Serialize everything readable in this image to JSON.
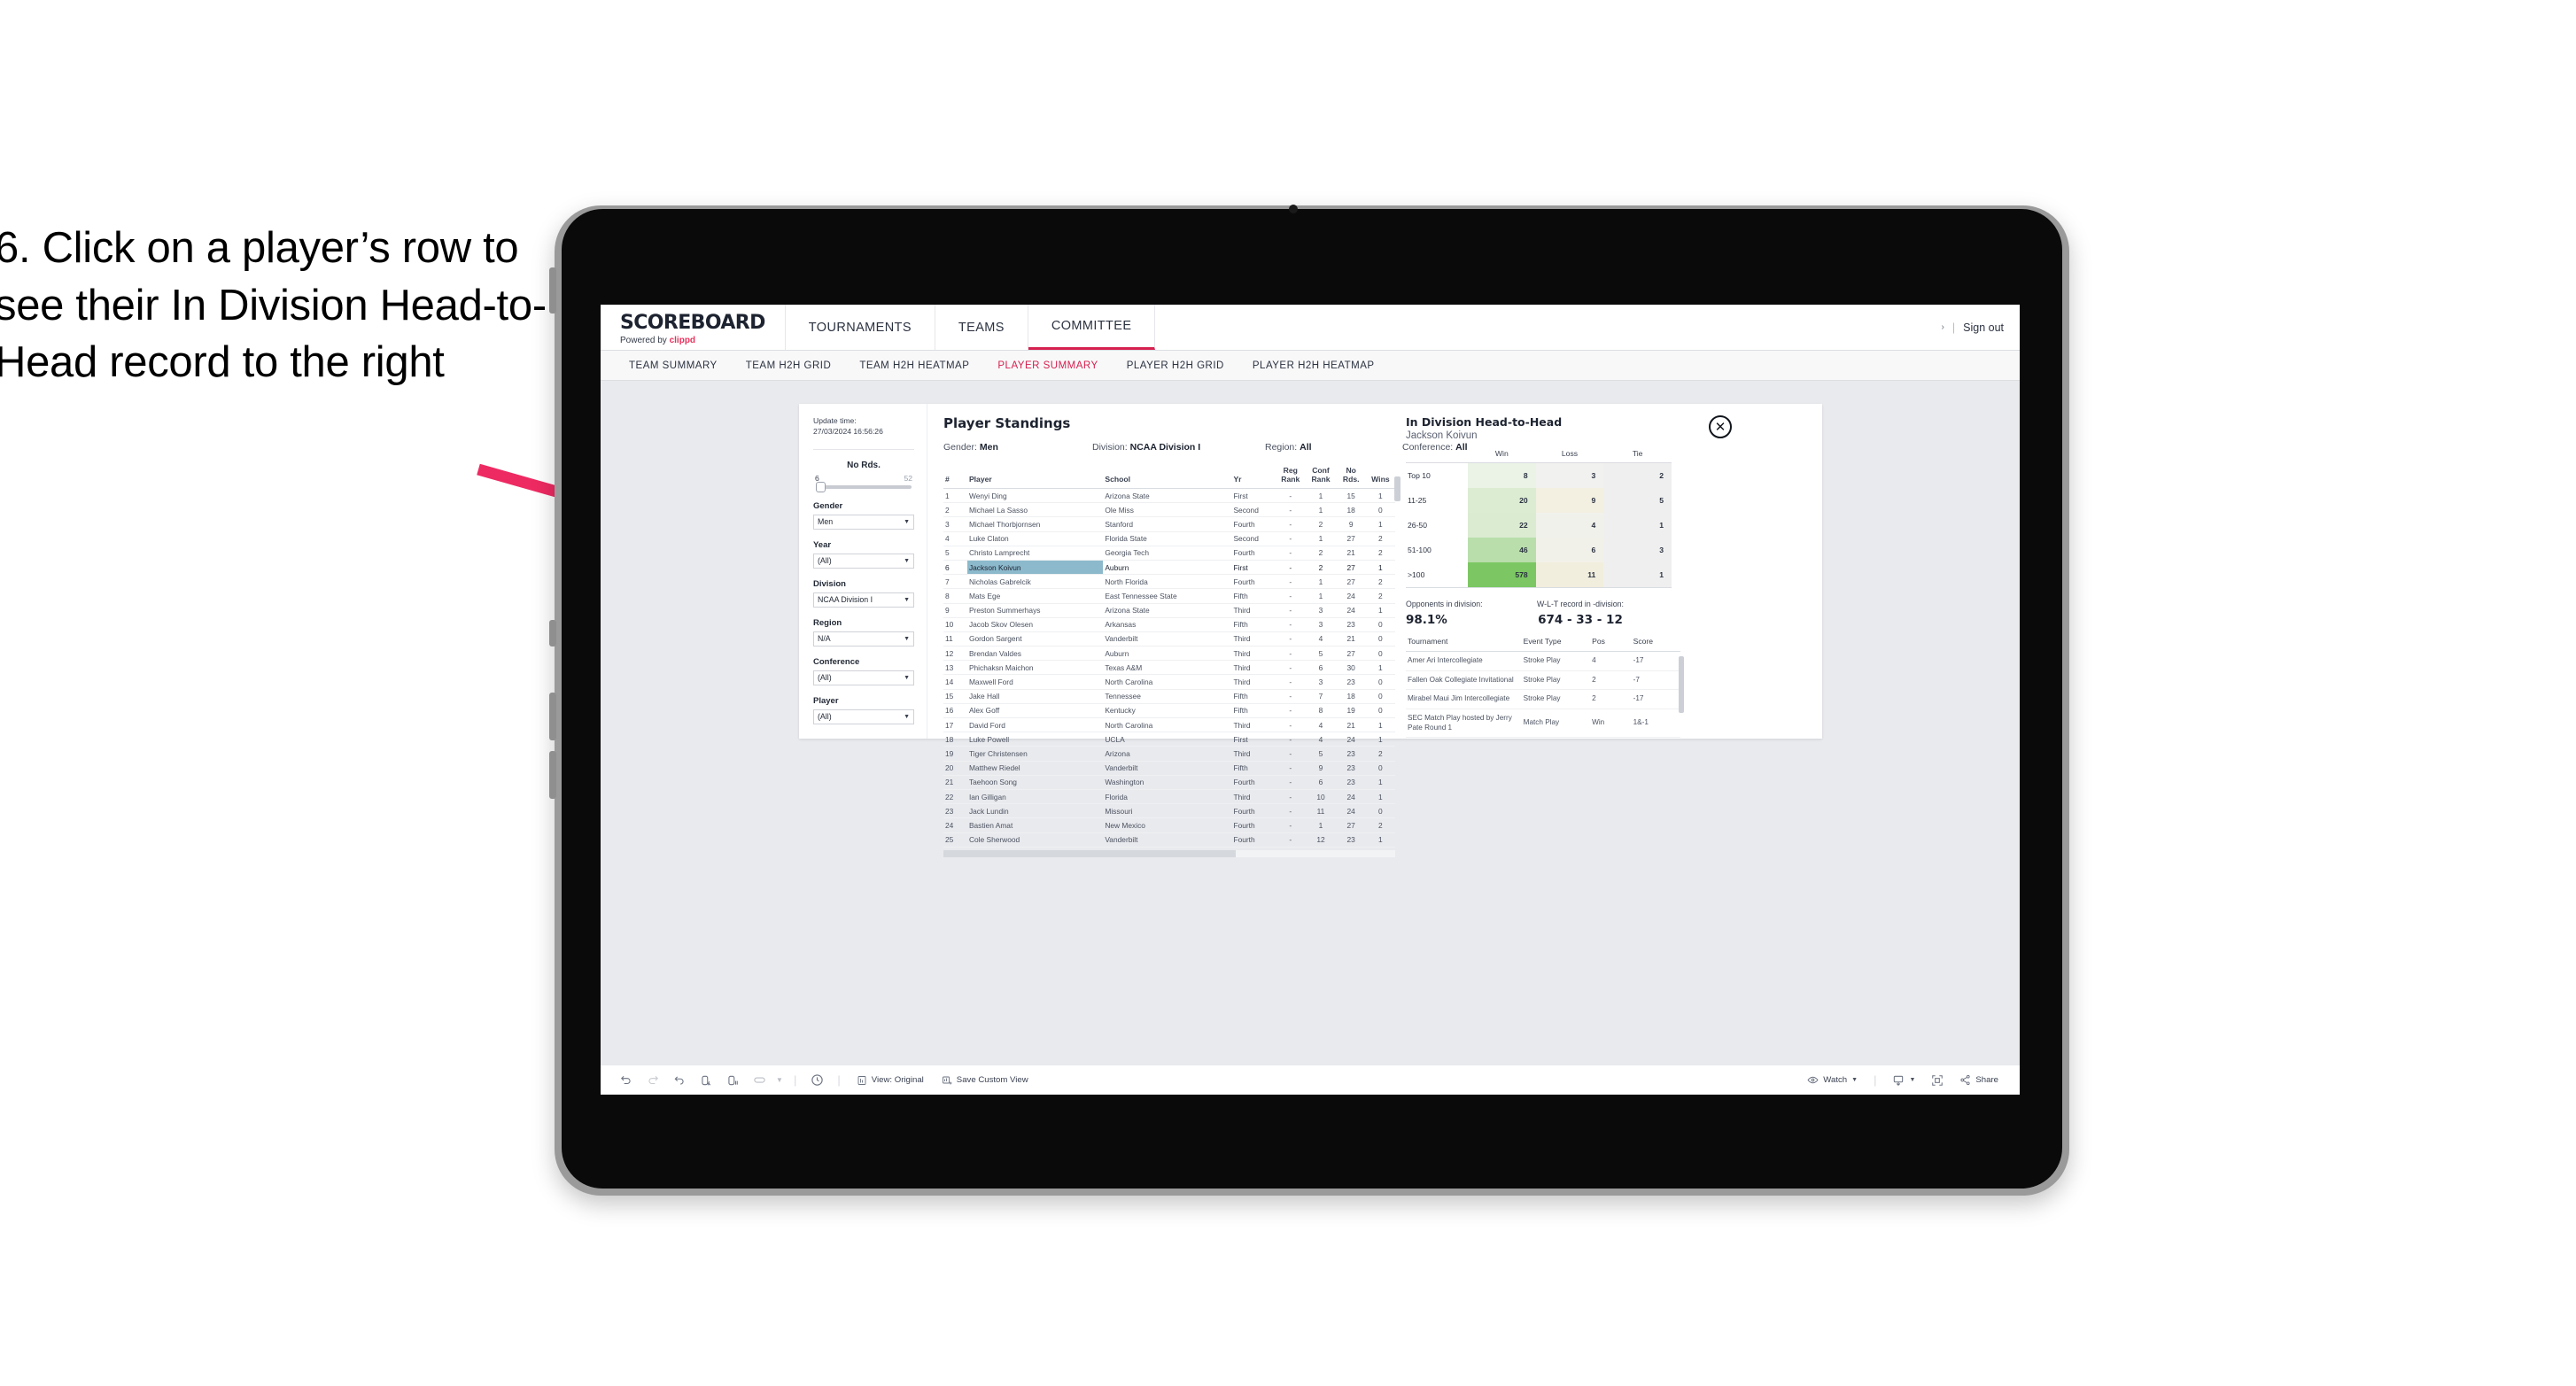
{
  "annotation": {
    "text": "6. Click on a player’s row to see their In Division Head-to-Head record to the right",
    "arrow_color": "#ee2a62"
  },
  "brand": {
    "title": "SCOREBOARD",
    "powered_prefix": "Powered by ",
    "powered_name": "clippd"
  },
  "topnav": {
    "items": [
      {
        "label": "TOURNAMENTS",
        "active": false
      },
      {
        "label": "TEAMS",
        "active": false
      },
      {
        "label": "COMMITTEE",
        "active": true
      }
    ],
    "chevron": "›",
    "separator": "|",
    "sign_out": "Sign out"
  },
  "subnav": {
    "items": [
      {
        "label": "TEAM SUMMARY",
        "active": false
      },
      {
        "label": "TEAM H2H GRID",
        "active": false
      },
      {
        "label": "TEAM H2H HEATMAP",
        "active": false
      },
      {
        "label": "PLAYER SUMMARY",
        "active": true
      },
      {
        "label": "PLAYER H2H GRID",
        "active": false
      },
      {
        "label": "PLAYER H2H HEATMAP",
        "active": false
      }
    ]
  },
  "filters": {
    "update_label": "Update time:",
    "update_time": "27/03/2024 16:56:26",
    "slider": {
      "title": "No Rds.",
      "min": "6",
      "max": "52"
    },
    "groups": [
      {
        "label": "Gender",
        "value": "Men"
      },
      {
        "label": "Year",
        "value": "(All)"
      },
      {
        "label": "Division",
        "value": "NCAA Division I"
      },
      {
        "label": "Region",
        "value": "N/A"
      },
      {
        "label": "Conference",
        "value": "(All)"
      },
      {
        "label": "Player",
        "value": "(All)"
      }
    ]
  },
  "standings": {
    "title": "Player Standings",
    "meta": [
      {
        "label": "Gender: ",
        "value": "Men"
      },
      {
        "label": "Division: ",
        "value": "NCAA Division I"
      },
      {
        "label": "Region: ",
        "value": "All"
      },
      {
        "label": "Conference: ",
        "value": "All"
      }
    ],
    "columns": [
      "#",
      "Player",
      "School",
      "Yr",
      "Reg Rank",
      "Conf Rank",
      "No Rds.",
      "Wins"
    ],
    "rows": [
      {
        "n": "1",
        "player": "Wenyi Ding",
        "school": "Arizona State",
        "yr": "First",
        "reg": "-",
        "conf": "1",
        "rds": "15",
        "wins": "1",
        "selected": false
      },
      {
        "n": "2",
        "player": "Michael La Sasso",
        "school": "Ole Miss",
        "yr": "Second",
        "reg": "-",
        "conf": "1",
        "rds": "18",
        "wins": "0",
        "selected": false
      },
      {
        "n": "3",
        "player": "Michael Thorbjornsen",
        "school": "Stanford",
        "yr": "Fourth",
        "reg": "-",
        "conf": "2",
        "rds": "9",
        "wins": "1",
        "selected": false
      },
      {
        "n": "4",
        "player": "Luke Claton",
        "school": "Florida State",
        "yr": "Second",
        "reg": "-",
        "conf": "1",
        "rds": "27",
        "wins": "2",
        "selected": false
      },
      {
        "n": "5",
        "player": "Christo Lamprecht",
        "school": "Georgia Tech",
        "yr": "Fourth",
        "reg": "-",
        "conf": "2",
        "rds": "21",
        "wins": "2",
        "selected": false
      },
      {
        "n": "6",
        "player": "Jackson Koivun",
        "school": "Auburn",
        "yr": "First",
        "reg": "-",
        "conf": "2",
        "rds": "27",
        "wins": "1",
        "selected": true
      },
      {
        "n": "7",
        "player": "Nicholas Gabrelcik",
        "school": "North Florida",
        "yr": "Fourth",
        "reg": "-",
        "conf": "1",
        "rds": "27",
        "wins": "2",
        "selected": false
      },
      {
        "n": "8",
        "player": "Mats Ege",
        "school": "East Tennessee State",
        "yr": "Fifth",
        "reg": "-",
        "conf": "1",
        "rds": "24",
        "wins": "2",
        "selected": false
      },
      {
        "n": "9",
        "player": "Preston Summerhays",
        "school": "Arizona State",
        "yr": "Third",
        "reg": "-",
        "conf": "3",
        "rds": "24",
        "wins": "1",
        "selected": false
      },
      {
        "n": "10",
        "player": "Jacob Skov Olesen",
        "school": "Arkansas",
        "yr": "Fifth",
        "reg": "-",
        "conf": "3",
        "rds": "23",
        "wins": "0",
        "selected": false
      },
      {
        "n": "11",
        "player": "Gordon Sargent",
        "school": "Vanderbilt",
        "yr": "Third",
        "reg": "-",
        "conf": "4",
        "rds": "21",
        "wins": "0",
        "selected": false
      },
      {
        "n": "12",
        "player": "Brendan Valdes",
        "school": "Auburn",
        "yr": "Third",
        "reg": "-",
        "conf": "5",
        "rds": "27",
        "wins": "0",
        "selected": false
      },
      {
        "n": "13",
        "player": "Phichaksn Maichon",
        "school": "Texas A&M",
        "yr": "Third",
        "reg": "-",
        "conf": "6",
        "rds": "30",
        "wins": "1",
        "selected": false
      },
      {
        "n": "14",
        "player": "Maxwell Ford",
        "school": "North Carolina",
        "yr": "Third",
        "reg": "-",
        "conf": "3",
        "rds": "23",
        "wins": "0",
        "selected": false
      },
      {
        "n": "15",
        "player": "Jake Hall",
        "school": "Tennessee",
        "yr": "Fifth",
        "reg": "-",
        "conf": "7",
        "rds": "18",
        "wins": "0",
        "selected": false
      },
      {
        "n": "16",
        "player": "Alex Goff",
        "school": "Kentucky",
        "yr": "Fifth",
        "reg": "-",
        "conf": "8",
        "rds": "19",
        "wins": "0",
        "selected": false
      },
      {
        "n": "17",
        "player": "David Ford",
        "school": "North Carolina",
        "yr": "Third",
        "reg": "-",
        "conf": "4",
        "rds": "21",
        "wins": "1",
        "selected": false
      },
      {
        "n": "18",
        "player": "Luke Powell",
        "school": "UCLA",
        "yr": "First",
        "reg": "-",
        "conf": "4",
        "rds": "24",
        "wins": "1",
        "selected": false
      },
      {
        "n": "19",
        "player": "Tiger Christensen",
        "school": "Arizona",
        "yr": "Third",
        "reg": "-",
        "conf": "5",
        "rds": "23",
        "wins": "2",
        "selected": false
      },
      {
        "n": "20",
        "player": "Matthew Riedel",
        "school": "Vanderbilt",
        "yr": "Fifth",
        "reg": "-",
        "conf": "9",
        "rds": "23",
        "wins": "0",
        "selected": false
      },
      {
        "n": "21",
        "player": "Taehoon Song",
        "school": "Washington",
        "yr": "Fourth",
        "reg": "-",
        "conf": "6",
        "rds": "23",
        "wins": "1",
        "selected": false
      },
      {
        "n": "22",
        "player": "Ian Gilligan",
        "school": "Florida",
        "yr": "Third",
        "reg": "-",
        "conf": "10",
        "rds": "24",
        "wins": "1",
        "selected": false
      },
      {
        "n": "23",
        "player": "Jack Lundin",
        "school": "Missouri",
        "yr": "Fourth",
        "reg": "-",
        "conf": "11",
        "rds": "24",
        "wins": "0",
        "selected": false
      },
      {
        "n": "24",
        "player": "Bastien Amat",
        "school": "New Mexico",
        "yr": "Fourth",
        "reg": "-",
        "conf": "1",
        "rds": "27",
        "wins": "2",
        "selected": false
      },
      {
        "n": "25",
        "player": "Cole Sherwood",
        "school": "Vanderbilt",
        "yr": "Fourth",
        "reg": "-",
        "conf": "12",
        "rds": "23",
        "wins": "1",
        "selected": false
      }
    ]
  },
  "h2h": {
    "title": "In Division Head-to-Head",
    "player": "Jackson Koivun",
    "close_icon": "close-icon",
    "columns": [
      "Win",
      "Loss",
      "Tie"
    ],
    "rows": [
      {
        "label": "Top 10",
        "win": "8",
        "loss": "3",
        "tie": "2",
        "win_color": "#eaf3e6",
        "loss_color": "#f1f1ef",
        "tie_color": "#efefef"
      },
      {
        "label": "11-25",
        "win": "20",
        "loss": "9",
        "tie": "5",
        "win_color": "#dcecd2",
        "loss_color": "#f3f0e2",
        "tie_color": "#efefef"
      },
      {
        "label": "26-50",
        "win": "22",
        "loss": "4",
        "tie": "1",
        "win_color": "#dbebd1",
        "loss_color": "#f1f1ec",
        "tie_color": "#efefef"
      },
      {
        "label": "51-100",
        "win": "46",
        "loss": "6",
        "tie": "3",
        "win_color": "#b9deab",
        "loss_color": "#f2f1e9",
        "tie_color": "#efefef"
      },
      {
        "label": ">100",
        "win": "578",
        "loss": "11",
        "tie": "1",
        "win_color": "#7cc763",
        "loss_color": "#f2eedd",
        "tie_color": "#efefef"
      }
    ],
    "kpis": [
      {
        "label": "Opponents in division:",
        "value": "98.1%"
      },
      {
        "label": "W-L-T record in -division:",
        "value": "674 - 33 - 12"
      }
    ],
    "tournament_columns": [
      "Tournament",
      "Event Type",
      "Pos",
      "Score"
    ],
    "tournaments": [
      {
        "name": "Amer Ari Intercollegiate",
        "type": "Stroke Play",
        "pos": "4",
        "score": "-17"
      },
      {
        "name": "Fallen Oak Collegiate Invitational",
        "type": "Stroke Play",
        "pos": "2",
        "score": "-7"
      },
      {
        "name": "Mirabel Maui Jim Intercollegiate",
        "type": "Stroke Play",
        "pos": "2",
        "score": "-17"
      },
      {
        "name": "SEC Match Play hosted by Jerry Pate Round 1",
        "type": "Match Play",
        "pos": "Win",
        "score": "1&-1"
      }
    ]
  },
  "toolbar": {
    "view_label": "View: Original",
    "save_label": "Save Custom View",
    "watch_label": "Watch",
    "share_label": "Share",
    "icons": [
      "undo-icon",
      "redo-icon",
      "revert-icon",
      "refresh-icon",
      "pause-icon",
      "pill-icon",
      "chevron-down-icon",
      "dashboard-icon"
    ]
  }
}
